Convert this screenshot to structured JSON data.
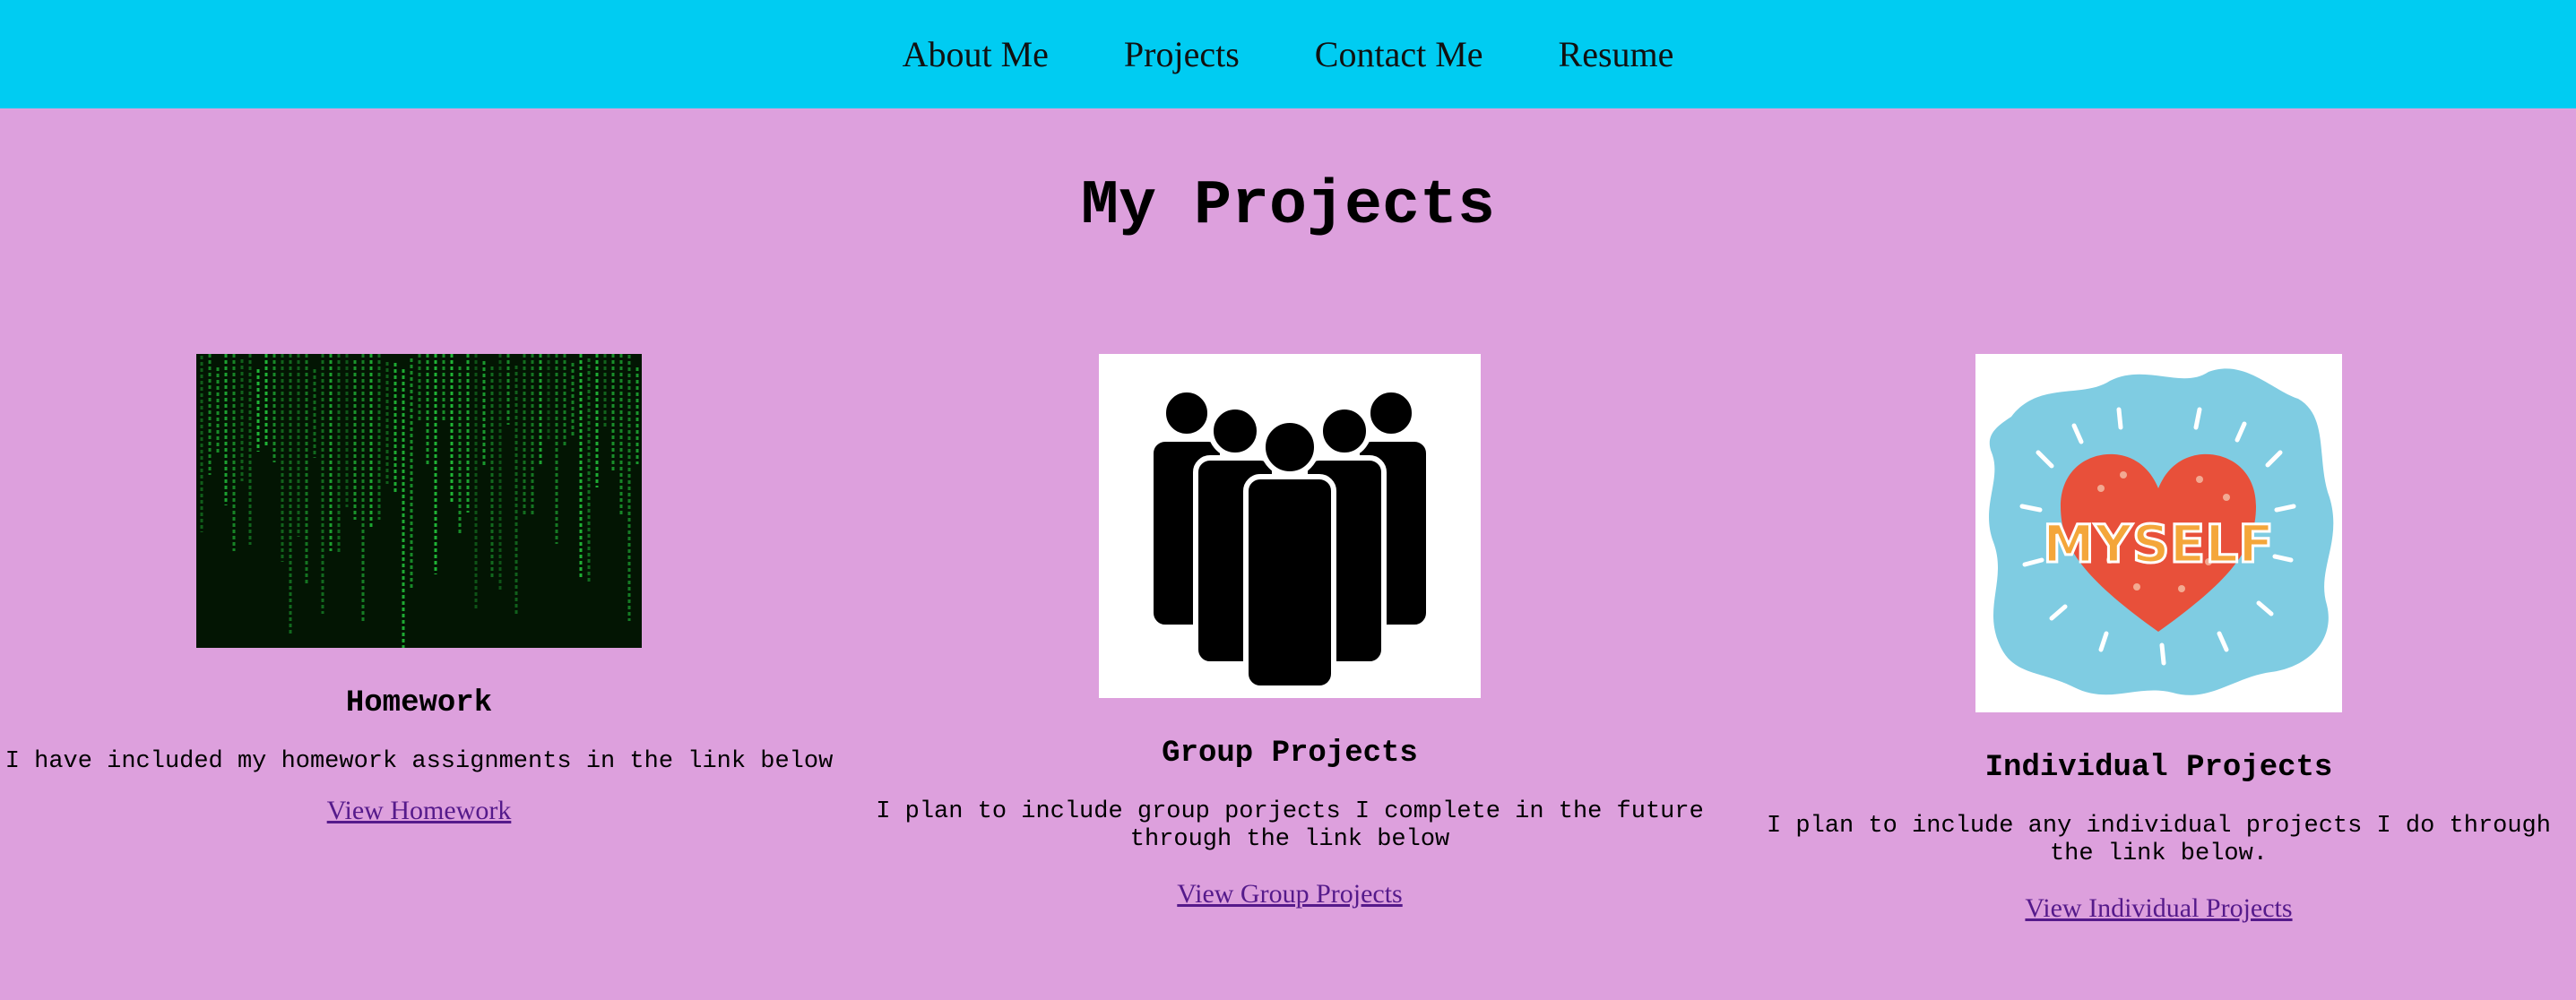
{
  "nav": {
    "items": [
      {
        "label": "About Me"
      },
      {
        "label": "Projects"
      },
      {
        "label": "Contact Me"
      },
      {
        "label": "Resume"
      }
    ],
    "background": "#00ccf2"
  },
  "page": {
    "title": "My Projects",
    "background": "#dda0dd"
  },
  "cards": [
    {
      "image": "matrix-code-image",
      "heading": "Homework",
      "description": "I have included my homework assignments in the link below",
      "link_text": "View Homework"
    },
    {
      "image": "group-people-icon",
      "heading": "Group Projects",
      "description": "I plan to include group porjects I complete in the future through the link below",
      "link_text": "View Group Projects"
    },
    {
      "image": "myself-heart-image",
      "image_text": "MYSELF",
      "heading": "Individual Projects",
      "description": "I plan to include any individual projects I do through the link below.",
      "link_text": "View Individual Projects"
    }
  ],
  "colors": {
    "link": "#551a8b",
    "matrix_green": "#22c03a"
  }
}
